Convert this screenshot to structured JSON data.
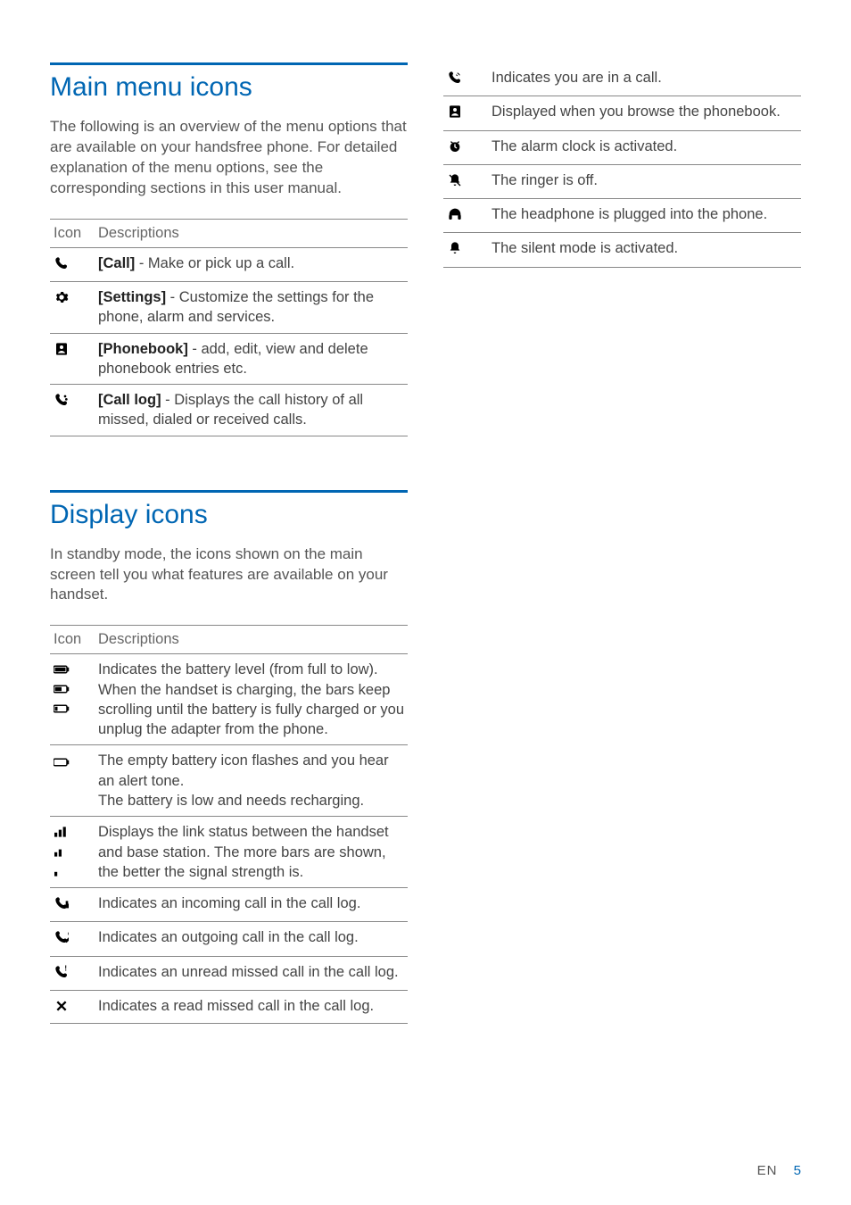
{
  "sections": {
    "main_menu": {
      "title": "Main menu icons",
      "intro": "The following is an overview of the menu options that are available on your handsfree phone. For detailed explanation of the menu options, see the corresponding sections in this user manual.",
      "col_icon": "Icon",
      "col_desc": "Descriptions",
      "rows": [
        {
          "icon": "call-icon",
          "label": "[Call]",
          "text": " - Make or pick up a call."
        },
        {
          "icon": "settings-icon",
          "label": "[Settings]",
          "text": " - Customize the settings for the phone, alarm and services."
        },
        {
          "icon": "phonebook-icon",
          "label": "[Phonebook]",
          "text": " - add, edit, view and delete phonebook entries etc."
        },
        {
          "icon": "calllog-icon",
          "label": "[Call log]",
          "text": " - Displays the call history of all missed, dialed or received calls."
        }
      ]
    },
    "display": {
      "title": "Display icons",
      "intro": "In standby mode, the icons shown on the main screen tell you what features are available on your handset.",
      "col_icon": "Icon",
      "col_desc": "Descriptions",
      "rows_left": [
        {
          "icons": [
            "battery-full-icon",
            "battery-mid-icon",
            "battery-low-icon"
          ],
          "text": "Indicates the battery level (from full to low).\nWhen the handset is charging, the bars keep scrolling until the battery is fully charged or you unplug the adapter from the phone."
        },
        {
          "icons": [
            "battery-empty-icon"
          ],
          "text": "The empty battery icon flashes and you hear an alert tone.\nThe battery is low and needs recharging."
        },
        {
          "icons": [
            "signal-3-icon",
            "signal-2-icon",
            "signal-1-icon"
          ],
          "text": "Displays the link status between the handset and base station. The more bars are shown, the better the signal strength is."
        },
        {
          "icons": [
            "incoming-call-icon"
          ],
          "text": "Indicates an incoming call in the call log."
        },
        {
          "icons": [
            "outgoing-call-icon"
          ],
          "text": "Indicates an outgoing call in the call log."
        },
        {
          "icons": [
            "missed-unread-icon"
          ],
          "text": "Indicates an unread missed call in the call log."
        },
        {
          "icons": [
            "missed-read-icon"
          ],
          "text": "Indicates a read missed call in the call log."
        }
      ],
      "rows_right": [
        {
          "icons": [
            "in-call-icon"
          ],
          "text": "Indicates you are in a call."
        },
        {
          "icons": [
            "phonebook-browse-icon"
          ],
          "text": "Displayed when you browse the phonebook."
        },
        {
          "icons": [
            "alarm-icon"
          ],
          "text": "The alarm clock is activated."
        },
        {
          "icons": [
            "ringer-off-icon"
          ],
          "text": "The ringer is off."
        },
        {
          "icons": [
            "headphone-icon"
          ],
          "text": "The headphone is plugged into the phone."
        },
        {
          "icons": [
            "silent-mode-icon"
          ],
          "text": "The silent mode is activated."
        }
      ]
    }
  },
  "footer": {
    "lang": "EN",
    "page": "5"
  }
}
